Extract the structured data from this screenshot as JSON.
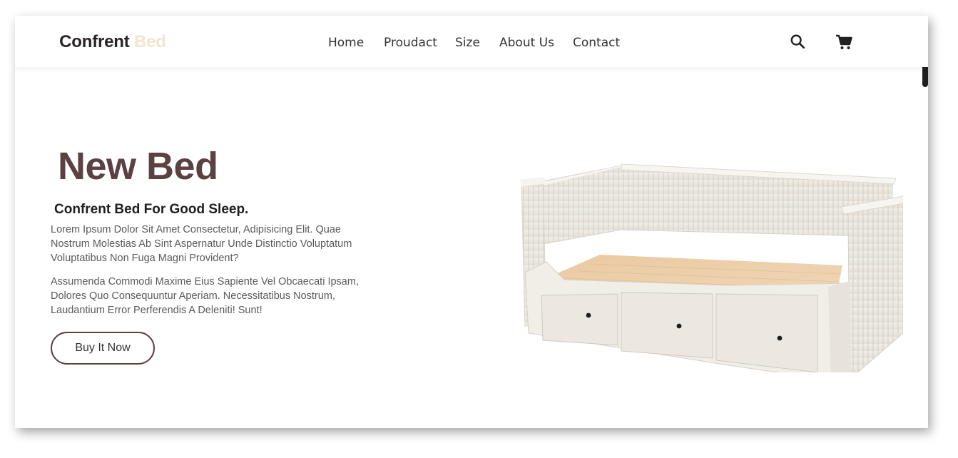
{
  "brand": {
    "dot": ".",
    "name": "Confrent",
    "accent": "Bed"
  },
  "nav": {
    "items": [
      "Home",
      "Proudact",
      "Size",
      "About Us",
      "Contact"
    ]
  },
  "icons": {
    "search": "search-icon",
    "cart": "cart-icon"
  },
  "hero": {
    "title": "New Bed",
    "subtitle": "Confrent Bed For Good Sleep.",
    "p1": "Lorem Ipsum Dolor Sit Amet Consectetur, Adipisicing Elit. Quae Nostrum Molestias Ab Sint Aspernatur Unde Distinctio Voluptatum Voluptatibus Non Fuga Magni Provident?",
    "p2": "Assumenda Commodi Maxime Eius Sapiente Vel Obcaecati Ipsam, Dolores Quo Consequuntur Aperiam. Necessitatibus Nostrum, Laudantium Error Perferendis A Deleniti! Sunt!",
    "cta": "Buy It Now"
  },
  "colors": {
    "title": "#5b4141",
    "accent": "#f3e4d4",
    "text": "#333333"
  }
}
